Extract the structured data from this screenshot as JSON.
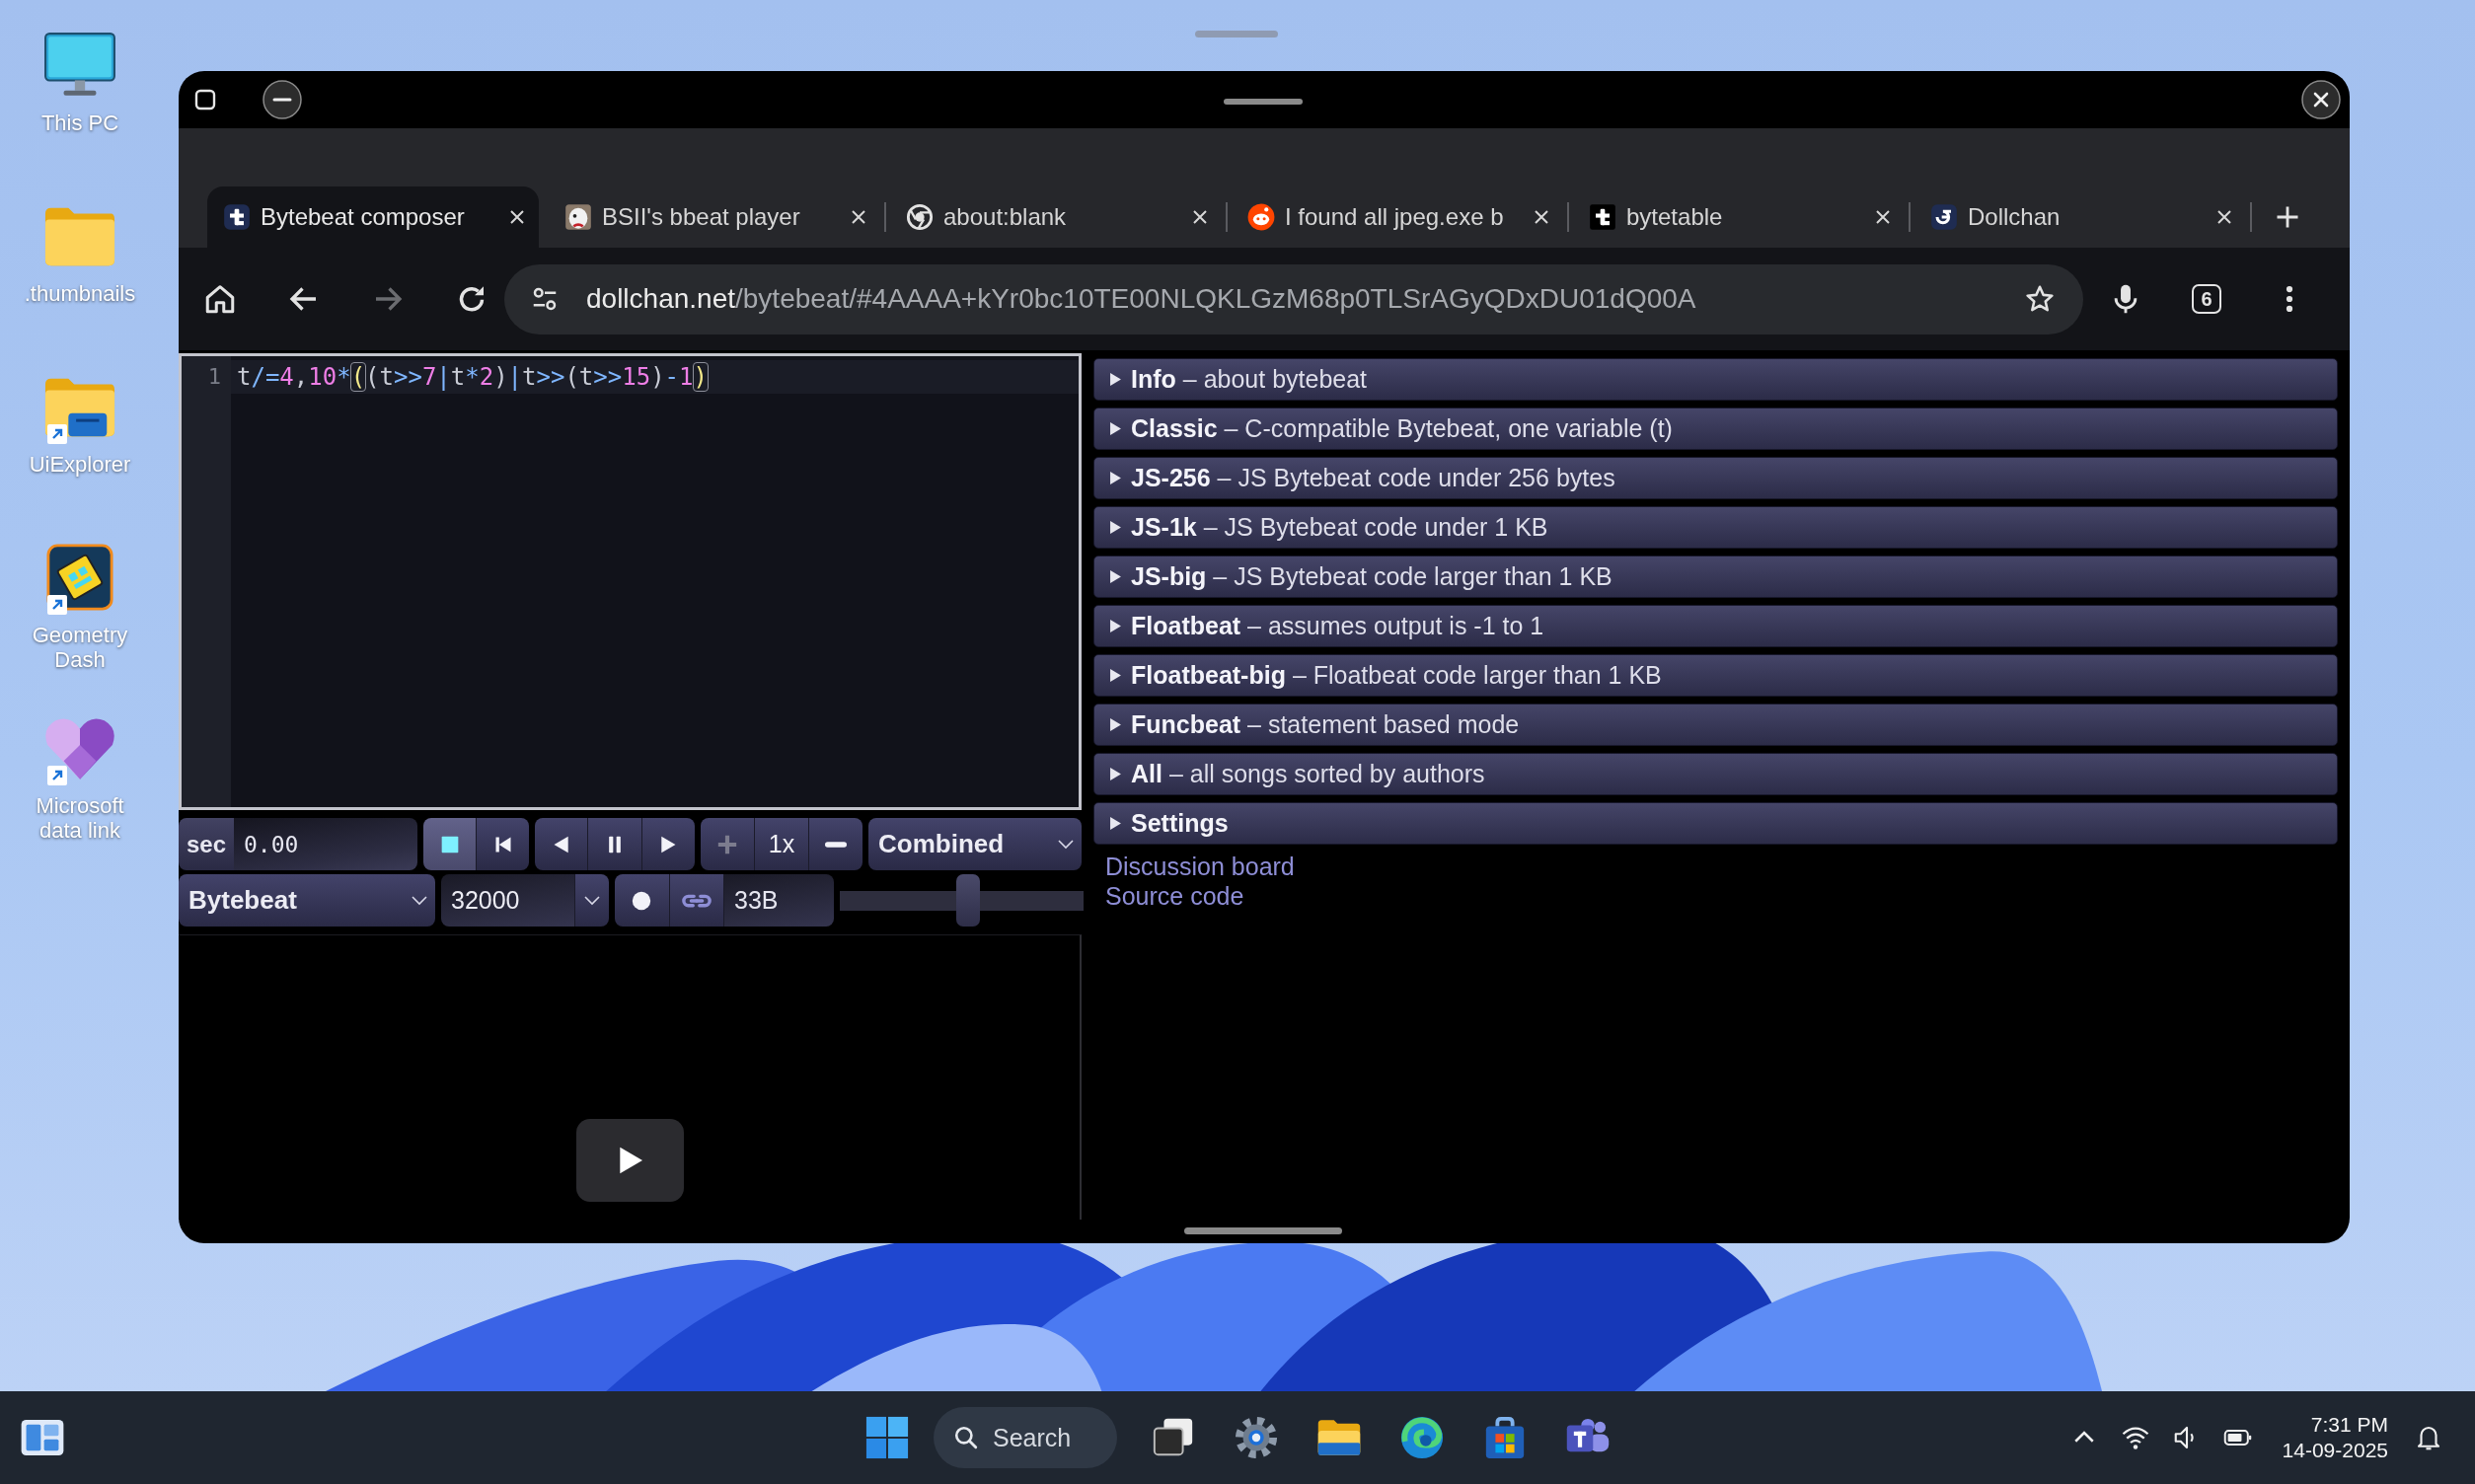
{
  "desktop_icons": [
    {
      "label": "This PC",
      "shortcut": false
    },
    {
      "label": ".thumbnails",
      "shortcut": false
    },
    {
      "label": "UiExplorer",
      "shortcut": true
    },
    {
      "label": "Geometry Dash",
      "shortcut": true
    },
    {
      "label": "Microsoft data link",
      "shortcut": true
    }
  ],
  "browser": {
    "tabs": [
      {
        "title": "Bytebeat composer",
        "selected": true
      },
      {
        "title": "BSII's bbeat player",
        "selected": false
      },
      {
        "title": "about:blank",
        "selected": false
      },
      {
        "title": "I found all jpeg.exe b",
        "selected": false
      },
      {
        "title": "bytetable",
        "selected": false
      },
      {
        "title": "Dollchan",
        "selected": false
      }
    ],
    "nav_buttons": [
      {
        "kind": "home",
        "disabled": false
      },
      {
        "kind": "back",
        "disabled": false
      },
      {
        "kind": "forward",
        "disabled": true
      },
      {
        "kind": "reload",
        "disabled": false
      }
    ],
    "address_bar": {
      "domain": "dollchan.net",
      "path": "/bytebeat/#4AAAA+kYr0bc10TE00NLQKLGzM68p0TLSrAGyQDxDU01dQ00A"
    },
    "tab_count": "6"
  },
  "editor": {
    "lines": [
      {
        "number": "1",
        "active": true,
        "tokens": [
          {
            "text": "t",
            "kind": "plain"
          },
          {
            "text": "/=",
            "kind": "operator"
          },
          {
            "text": "4",
            "kind": "number"
          },
          {
            "text": ",",
            "kind": "plain"
          },
          {
            "text": "10",
            "kind": "number"
          },
          {
            "text": "*",
            "kind": "operator"
          },
          {
            "text": "(",
            "kind": "match"
          },
          {
            "text": "(t",
            "kind": "plain"
          },
          {
            "text": ">>",
            "kind": "operator"
          },
          {
            "text": "7",
            "kind": "number"
          },
          {
            "text": "|",
            "kind": "operator"
          },
          {
            "text": "t",
            "kind": "plain"
          },
          {
            "text": "*",
            "kind": "operator"
          },
          {
            "text": "2",
            "kind": "number"
          },
          {
            "text": ")",
            "kind": "plain"
          },
          {
            "text": "|",
            "kind": "operator"
          },
          {
            "text": "t",
            "kind": "plain"
          },
          {
            "text": ">>",
            "kind": "operator"
          },
          {
            "text": "(t",
            "kind": "plain"
          },
          {
            "text": ">>",
            "kind": "operator"
          },
          {
            "text": "15",
            "kind": "number"
          },
          {
            "text": ")",
            "kind": "plain"
          },
          {
            "text": "-",
            "kind": "operator"
          },
          {
            "text": "1",
            "kind": "number"
          },
          {
            "text": ")",
            "kind": "match"
          }
        ]
      }
    ]
  },
  "controls": {
    "time_unit": "sec",
    "time": "0.00",
    "transport": [
      [
        {
          "kind": "stop",
          "selected": true,
          "disabled": false
        },
        {
          "kind": "skip-back",
          "selected": false,
          "disabled": false
        }
      ],
      [
        {
          "kind": "reverse",
          "selected": false,
          "disabled": false
        },
        {
          "kind": "pause",
          "selected": false,
          "disabled": false
        },
        {
          "kind": "play",
          "selected": false,
          "disabled": false
        }
      ],
      [
        {
          "kind": "faster",
          "selected": false,
          "disabled": true
        },
        {
          "kind": "speed",
          "label": "1x",
          "selected": false,
          "disabled": false
        },
        {
          "kind": "slower",
          "selected": false,
          "disabled": false
        }
      ]
    ],
    "display_mode": "Combined",
    "mode": "Bytebeat",
    "sample_rate": "32000",
    "code_size": "33B",
    "volume": {
      "level": 0.53
    }
  },
  "sections": [
    {
      "title": "Info",
      "description": "– about bytebeat",
      "expanded": false
    },
    {
      "title": "Classic",
      "description": "– C-compatible Bytebeat, one variable (t)",
      "expanded": false
    },
    {
      "title": "JS-256",
      "description": "– JS Bytebeat code under 256 bytes",
      "expanded": false
    },
    {
      "title": "JS-1k",
      "description": "– JS Bytebeat code under 1 KB",
      "expanded": false
    },
    {
      "title": "JS-big",
      "description": "– JS Bytebeat code larger than 1 KB",
      "expanded": false
    },
    {
      "title": "Floatbeat",
      "description": "– assumes output is -1 to 1",
      "expanded": false
    },
    {
      "title": "Floatbeat-big",
      "description": "– Floatbeat code larger than 1 KB",
      "expanded": false
    },
    {
      "title": "Funcbeat",
      "description": "– statement based mode",
      "expanded": false
    },
    {
      "title": "All",
      "description": "– all songs sorted by authors",
      "expanded": false
    },
    {
      "title": "Settings",
      "expanded": false
    }
  ],
  "links": [
    {
      "label": "Discussion board"
    },
    {
      "label": "Source code"
    }
  ],
  "taskbar": {
    "search": "Search",
    "time": "7:31 PM",
    "date": "14-09-2025"
  }
}
